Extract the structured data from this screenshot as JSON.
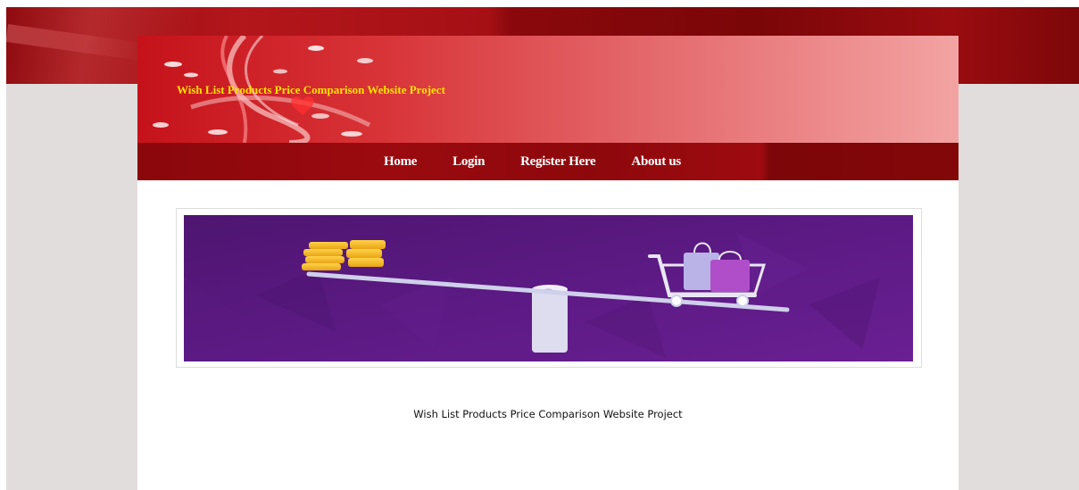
{
  "header": {
    "site_title": "Wish List Products Price Comparison Website Project"
  },
  "nav": {
    "items": [
      {
        "label": "Home"
      },
      {
        "label": "Login"
      },
      {
        "label": "Register Here"
      },
      {
        "label": "About us"
      }
    ]
  },
  "main": {
    "banner_image": "price-comparison-illustration",
    "caption": "Wish List Products Price Comparison Website Project"
  },
  "colors": {
    "header_red": "#c5121a",
    "nav_red": "#8a070b",
    "title_yellow": "#ffe200",
    "banner_purple": "#5a1780",
    "page_bg": "#e0dddc"
  }
}
